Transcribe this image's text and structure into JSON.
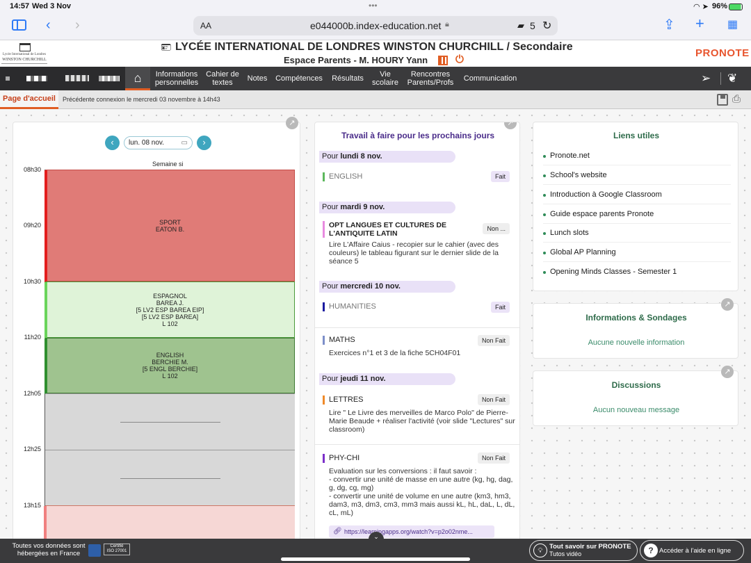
{
  "status": {
    "time": "14:57",
    "date": "Wed 3 Nov",
    "dots": "•••",
    "battery": "96%"
  },
  "browser": {
    "text_size": "AA",
    "url": "e044000b.index-education.net",
    "tabs_count": "5"
  },
  "header": {
    "title": "LYCÉE INTERNATIONAL DE LONDRES WINSTON CHURCHILL / Secondaire",
    "subtitle": "Espace Parents - M. HOURY Yann",
    "logo_line1": "Lycée International de Londres",
    "logo_line2": "WINSTON CHURCHILL",
    "brand": "PRONOTE"
  },
  "nav": {
    "items": [
      {
        "label": "Informations personnelles"
      },
      {
        "label": "Cahier de textes"
      },
      {
        "label": "Notes"
      },
      {
        "label": "Compétences"
      },
      {
        "label": "Résultats"
      },
      {
        "label": "Vie scolaire"
      },
      {
        "label": "Rencontres Parents/Profs"
      },
      {
        "label": "Communication"
      }
    ]
  },
  "subbar": {
    "tab": "Page d'accueil",
    "last_login": "Précédente connexion le mercredi 03 novembre à 14h43"
  },
  "timetable": {
    "date": "lun. 08 nov.",
    "week": "Semaine si",
    "times": [
      "08h30",
      "09h20",
      "10h30",
      "11h20",
      "12h05",
      "12h25",
      "13h15"
    ],
    "lessons": [
      {
        "lines": [
          "SPORT",
          "EATON B."
        ],
        "color": "#e07b77",
        "bar": "#e31e1e"
      },
      {
        "lines": [
          "ESPAGNOL",
          "BAREA J.",
          "[5 LV2 ESP BAREA EIP]",
          "[5 LV2 ESP BAREA]",
          "L 102"
        ],
        "color": "#dff3d8",
        "bar": "#6ad45a"
      },
      {
        "lines": [
          "ENGLISH",
          "BERCHIE M.",
          "[5 ENGL BERCHIE]",
          "L 102"
        ],
        "color": "#9fc38f",
        "bar": "#2f8f2f"
      }
    ]
  },
  "homework": {
    "title": "Travail à faire pour les prochains jours",
    "days": [
      {
        "prefix": "Pour",
        "day": "lundi 8 nov."
      },
      {
        "prefix": "Pour",
        "day": "mardi 9 nov."
      },
      {
        "prefix": "Pour",
        "day": "mercredi 10 nov."
      },
      {
        "prefix": "Pour",
        "day": "jeudi 11 nov."
      }
    ],
    "items": [
      {
        "subject": "ENGLISH",
        "status": "Fait",
        "bar": "#5cb85c",
        "desc": ""
      },
      {
        "subject": "OPT LANGUES ET CULTURES DE L'ANTIQUITE LATIN",
        "status": "Non ...",
        "bar": "#e88be0",
        "desc": "Lire L'Affaire Caius - recopier sur le cahier (avec des couleurs) le tableau figurant sur le dernier slide de la séance 5"
      },
      {
        "subject": "HUMANITIES",
        "status": "Fait",
        "bar": "#1a1aa0",
        "desc": ""
      },
      {
        "subject": "MATHS",
        "status": "Non Fait",
        "bar": "#7d8fc9",
        "desc": "Exercices n°1 et 3 de la fiche 5CH04F01"
      },
      {
        "subject": "LETTRES",
        "status": "Non Fait",
        "bar": "#ef8a2a",
        "desc": "Lire \" Le Livre des merveilles de Marco Polo\" de Pierre-Marie Beaude + réaliser l'activité (voir slide \"Lectures\" sur classroom)"
      },
      {
        "subject": "PHY-CHI",
        "status": "Non Fait",
        "bar": "#7b2fc9",
        "desc": "Evaluation sur les conversions : il faut savoir :\n- convertir une unité de masse en une autre (kg, hg, dag, g, dg, cg, mg)\n- convertir une unité de volume en une autre (km3, hm3, dam3, m3, dm3, cm3, mm3 mais aussi kL, hL, daL, L, dL, cL, mL)"
      }
    ],
    "url": "https://learningapps.org/watch?v=p2o02nme..."
  },
  "links": {
    "title": "Liens utiles",
    "items": [
      "Pronote.net",
      "School's website",
      "Introduction à Google Classroom",
      "Guide espace parents Pronote",
      "Lunch slots",
      "Global AP Planning",
      "Opening Minds Classes - Semester 1"
    ]
  },
  "info": {
    "title": "Informations & Sondages",
    "empty": "Aucune nouvelle information"
  },
  "discussions": {
    "title": "Discussions",
    "empty": "Aucun nouveau message"
  },
  "footer": {
    "hosting1": "Toutes vos données sont",
    "hosting2": "hébergées en France",
    "cert1": "Certifié",
    "cert2": "ISO 27001",
    "pronote_title": "Tout savoir sur PRONOTE",
    "pronote_sub": "Tutos vidéo",
    "help": "Accéder à l'aide en ligne"
  }
}
